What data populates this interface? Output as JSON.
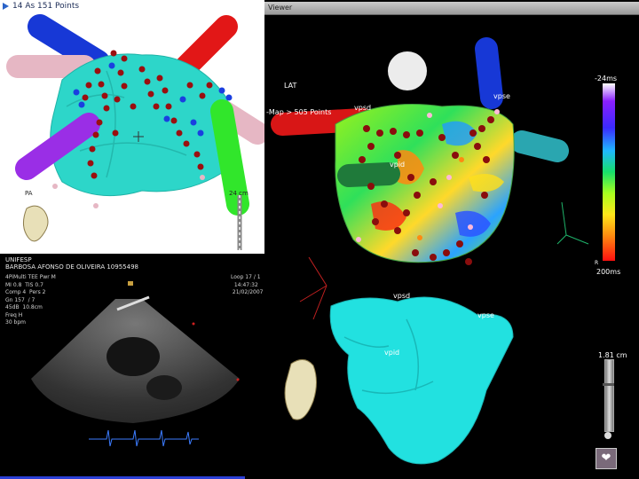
{
  "top_left": {
    "title": "14 As 151 Points",
    "label_pa": "PA",
    "label_scale": "24 cm"
  },
  "viewer": {
    "window_title": "Viewer",
    "label_lat": "LAT",
    "label_map": "-Map > 505 Points",
    "label_vpsd": "vpsd",
    "label_vpse": "vpse",
    "label_vpid": "vpid",
    "label_vpsd2": "vpsd",
    "label_vpse2": "vpse",
    "label_vpid2": "vpid",
    "scale_top": "-24ms",
    "scale_bottom": "200ms",
    "scale_r": "R",
    "depth": "1.81 cm",
    "heart_icon_glyph": "❤"
  },
  "ultrasound": {
    "institution": "UNIFESP",
    "patient": "BARBOSA AFONSO DE OLIVEIRA 10955498",
    "params": "4PiMulti TEE Pwr M\nMI 0.8  TIS 0.7\nComp 4  Pers 2\nGn 157  / 7\n45dB  10.8cm\nFreq H\n30 bpm",
    "loop": "Loop 17 / 1\n  14:47:32\n 21/02/2007"
  },
  "colors": {
    "mesh_cyan": "#2dd6c9",
    "dot_red": "#9a0f0f",
    "dot_blue": "#1a3fe0",
    "vessel_blue": "#1738d6",
    "vessel_red": "#e21717",
    "vessel_pink": "#e6b7c4",
    "vessel_purple": "#9a2ee6",
    "vessel_green": "#31e62b"
  }
}
